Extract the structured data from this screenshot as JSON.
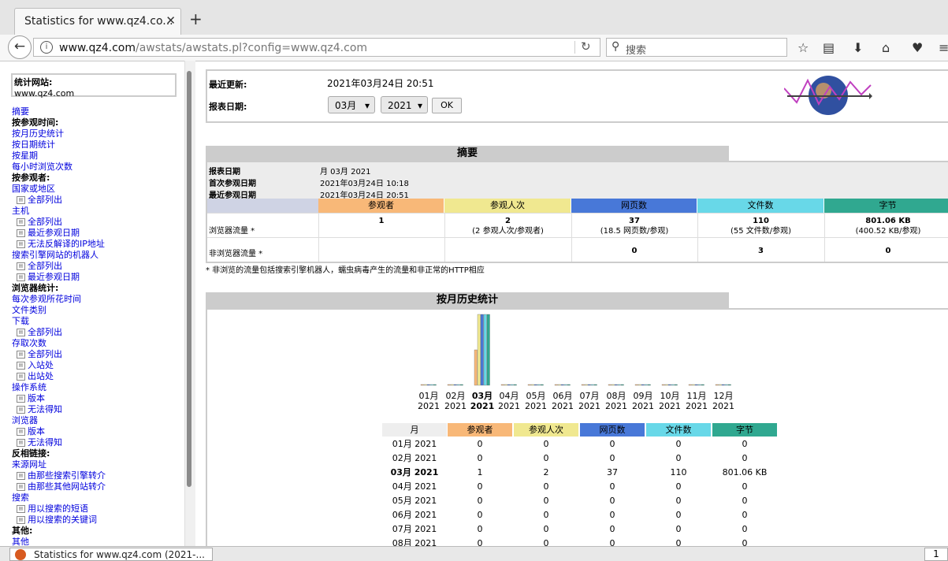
{
  "browser": {
    "tab_title": "Statistics for www.qz4.co...",
    "tab_close": "✕",
    "new_tab": "+",
    "url_domain": "www.qz4.com",
    "url_path": "/awstats/awstats.pl?config=www.qz4.com",
    "search_placeholder": "搜索"
  },
  "sidebar": {
    "site_label": "统计网站:",
    "site_value": "www.qz4.com",
    "menu": [
      {
        "text": "摘要",
        "kind": "l"
      },
      {
        "text": "按参观时间:",
        "kind": "h"
      },
      {
        "text": "按月历史统计",
        "kind": "l"
      },
      {
        "text": "按日期统计",
        "kind": "l"
      },
      {
        "text": "按星期",
        "kind": "l"
      },
      {
        "text": "每小时浏览次数",
        "kind": "l"
      },
      {
        "text": "按参观者:",
        "kind": "h"
      },
      {
        "text": "国家或地区",
        "kind": "l"
      },
      {
        "text": "全部列出",
        "kind": "s"
      },
      {
        "text": "主机",
        "kind": "l"
      },
      {
        "text": "全部列出",
        "kind": "s"
      },
      {
        "text": "最近参观日期",
        "kind": "s"
      },
      {
        "text": "无法反解译的IP地址",
        "kind": "s"
      },
      {
        "text": "搜索引擎网站的机器人",
        "kind": "l"
      },
      {
        "text": "全部列出",
        "kind": "s"
      },
      {
        "text": "最近参观日期",
        "kind": "s"
      },
      {
        "text": "浏览器统计:",
        "kind": "h"
      },
      {
        "text": "每次参观所花时间",
        "kind": "l"
      },
      {
        "text": "文件类别",
        "kind": "l"
      },
      {
        "text": "下载",
        "kind": "l"
      },
      {
        "text": "全部列出",
        "kind": "s"
      },
      {
        "text": "存取次数",
        "kind": "l"
      },
      {
        "text": "全部列出",
        "kind": "s"
      },
      {
        "text": "入站处",
        "kind": "s"
      },
      {
        "text": "出站处",
        "kind": "s"
      },
      {
        "text": "操作系统",
        "kind": "l"
      },
      {
        "text": "版本",
        "kind": "s"
      },
      {
        "text": "无法得知",
        "kind": "s"
      },
      {
        "text": "浏览器",
        "kind": "l"
      },
      {
        "text": "版本",
        "kind": "s"
      },
      {
        "text": "无法得知",
        "kind": "s"
      },
      {
        "text": "反相链接:",
        "kind": "h"
      },
      {
        "text": "来源网址",
        "kind": "l"
      },
      {
        "text": "由那些搜索引擎转介",
        "kind": "s"
      },
      {
        "text": "由那些其他网站转介",
        "kind": "s"
      },
      {
        "text": "搜索",
        "kind": "l"
      },
      {
        "text": "用以搜索的短语",
        "kind": "s"
      },
      {
        "text": "用以搜索的关键词",
        "kind": "s"
      },
      {
        "text": "其他:",
        "kind": "h"
      },
      {
        "text": "其他",
        "kind": "l"
      }
    ]
  },
  "top": {
    "last_update_label": "最近更新:",
    "last_update_value": "2021年03月24日 20:51",
    "report_date_label": "报表日期:",
    "month_select": "03月",
    "year_select": "2021",
    "ok_button": "OK"
  },
  "summary": {
    "title": "摘要",
    "report_date_label": "报表日期",
    "report_date_value": "月 03月 2021",
    "first_visit_label": "首次参观日期",
    "first_visit_value": "2021年03月24日 10:18",
    "last_visit_label": "最近参观日期",
    "last_visit_value": "2021年03月24日 20:51",
    "columns": [
      "参观者",
      "参观人次",
      "网页数",
      "文件数",
      "字节"
    ],
    "browser_row_label": "浏览器流量 *",
    "browser_row": [
      {
        "main": "1",
        "sub": ""
      },
      {
        "main": "2",
        "sub": "(2 参观人次/参观者)"
      },
      {
        "main": "37",
        "sub": "(18.5 网页数/参观)"
      },
      {
        "main": "110",
        "sub": "(55 文件数/参观)"
      },
      {
        "main": "801.06 KB",
        "sub": "(400.52 KB/参观)"
      }
    ],
    "nonbrowser_row_label": "非浏览器流量 *",
    "nonbrowser_row": [
      "",
      "",
      "0",
      "3",
      "0"
    ],
    "footnote": "* 非浏览的流量包括搜索引擎机器人，蠕虫病毒产生的流量和非正常的HTTP相应"
  },
  "history": {
    "title": "按月历史统计",
    "table_headers": [
      "月",
      "参观者",
      "参观人次",
      "网页数",
      "文件数",
      "字节"
    ],
    "colors": {
      "visitors": "#f8b878",
      "visits": "#f0e890",
      "pages": "#4878d8",
      "hits": "#68d8e8",
      "bytes": "#30a890"
    },
    "months": [
      {
        "m": "01月",
        "y": "2021",
        "label": "01月 2021",
        "vals": [
          "0",
          "0",
          "0",
          "0",
          "0"
        ],
        "bold": false
      },
      {
        "m": "02月",
        "y": "2021",
        "label": "02月 2021",
        "vals": [
          "0",
          "0",
          "0",
          "0",
          "0"
        ],
        "bold": false
      },
      {
        "m": "03月",
        "y": "2021",
        "label": "03月 2021",
        "vals": [
          "1",
          "2",
          "37",
          "110",
          "801.06 KB"
        ],
        "bold": true
      },
      {
        "m": "04月",
        "y": "2021",
        "label": "04月 2021",
        "vals": [
          "0",
          "0",
          "0",
          "0",
          "0"
        ],
        "bold": false
      },
      {
        "m": "05月",
        "y": "2021",
        "label": "05月 2021",
        "vals": [
          "0",
          "0",
          "0",
          "0",
          "0"
        ],
        "bold": false
      },
      {
        "m": "06月",
        "y": "2021",
        "label": "06月 2021",
        "vals": [
          "0",
          "0",
          "0",
          "0",
          "0"
        ],
        "bold": false
      },
      {
        "m": "07月",
        "y": "2021",
        "label": "07月 2021",
        "vals": [
          "0",
          "0",
          "0",
          "0",
          "0"
        ],
        "bold": false
      },
      {
        "m": "08月",
        "y": "2021",
        "label": "08月 2021",
        "vals": [
          "0",
          "0",
          "0",
          "0",
          "0"
        ],
        "bold": false
      },
      {
        "m": "09月",
        "y": "2021",
        "label": "",
        "vals": [],
        "bold": false
      },
      {
        "m": "10月",
        "y": "2021",
        "label": "",
        "vals": [],
        "bold": false
      },
      {
        "m": "11月",
        "y": "2021",
        "label": "",
        "vals": [],
        "bold": false
      },
      {
        "m": "12月",
        "y": "2021",
        "label": "",
        "vals": [],
        "bold": false
      }
    ]
  },
  "taskbar": {
    "item": "Statistics for www.qz4.com (2021-...",
    "pager": "1"
  }
}
